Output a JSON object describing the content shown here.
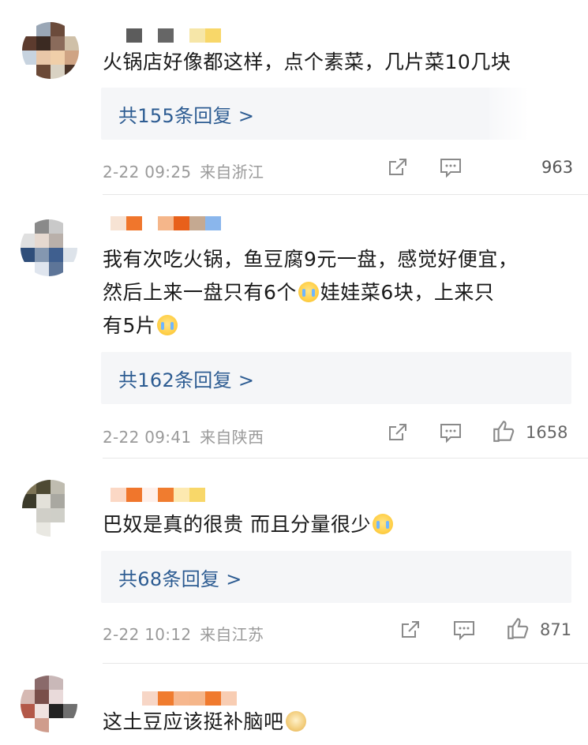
{
  "comments": [
    {
      "text": "火锅店好像都这样，点个素菜，几片菜10几块",
      "reply_label": "共155条回复 >",
      "date": "2-22 09:25",
      "location": "来自浙江",
      "likes": "963",
      "avatar_colors": [
        "#ffffff",
        "#9aa7b6",
        "#6b4b3b",
        "#ffffff",
        "#5c3b2e",
        "#3b2a22",
        "#8a6b5b",
        "#cfc0a8",
        "#c7d3df",
        "#e9c7a8",
        "#f0cfa9",
        "#cfa484",
        "#ffffff",
        "#6b4936",
        "#d9d2c3",
        "#4b3428"
      ],
      "name_colors": [
        "#5c5c5c",
        "#ffffff",
        "#666666",
        "#ffffff",
        "#f6e6a8",
        "#f8d769"
      ]
    },
    {
      "text_lines": [
        "我有次吃火锅，鱼豆腐9元一盘，感觉好便宜，",
        "然后上来一盘只有6个",
        "娃娃菜6块，上来只",
        "有5片"
      ],
      "reply_label": "共162条回复 >",
      "date": "2-22 09:41",
      "location": "来自陕西",
      "likes": "1658",
      "avatar_colors": [
        "#ffffff",
        "#8a8a8a",
        "#c9c9c9",
        "#ffffff",
        "#e0e0e0",
        "#e6d9d0",
        "#b9b0aa",
        "#ffffff",
        "#2f4e7a",
        "#8497b0",
        "#3f5f8f",
        "#dde3ea",
        "#ffffff",
        "#dfe5ee",
        "#5d7598",
        "#ffffff"
      ],
      "name_colors": [
        "#f7e3d4",
        "#f0762c",
        "#ffffff",
        "#f5b68a",
        "#e8601a",
        "#c5a991",
        "#8ab6ec"
      ]
    },
    {
      "text": "巴奴是真的很贵 而且分量很少",
      "reply_label": "共68条回复 >",
      "date": "2-22 10:12",
      "location": "来自江苏",
      "likes": "871",
      "avatar_colors": [
        "#7d7456",
        "#4e4a33",
        "#bfbcb0",
        "#ffffff",
        "#3b3a2a",
        "#e3e1d9",
        "#a9a8a1",
        "#ffffff",
        "#ffffff",
        "#d0cfc8",
        "#cfcfc8",
        "#ffffff",
        "#ffffff",
        "#e9e8e2",
        "#ffffff",
        "#ffffff"
      ],
      "name_colors": [
        "#fbd8c5",
        "#f0762c",
        "#fff0ea",
        "#f07c2f",
        "#fde9b0",
        "#f8d769"
      ]
    },
    {
      "text": "这土豆应该挺补脑吧",
      "avatar_colors": [
        "#ffffff",
        "#8a6a6a",
        "#c9b8b8",
        "#ffffff",
        "#d6b9b3",
        "#7a4f4a",
        "#e9dada",
        "#ffffff",
        "#b35848",
        "#f0e2df",
        "#222222",
        "#6f6f6f",
        "#ffffff",
        "#cf9c8c",
        "#ffffff",
        "#ffffff"
      ],
      "name_colors": [
        "#f7d6c6",
        "#f07c2f",
        "#f6b78e",
        "#f5b68a",
        "#f07a2e",
        "#f8cdb3"
      ]
    }
  ]
}
